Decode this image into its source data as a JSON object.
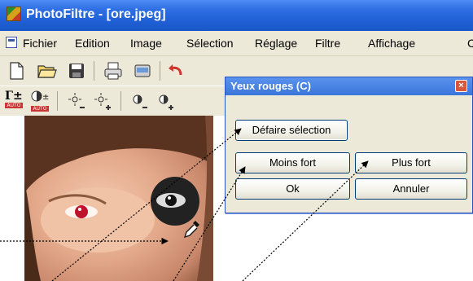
{
  "app": {
    "title": "PhotoFiltre - [ore.jpeg]"
  },
  "menubar": {
    "items": [
      "Fichier",
      "Edition",
      "Image",
      "Sélection",
      "Réglage",
      "Filtre",
      "Affichage",
      "C"
    ]
  },
  "toolbar1": {
    "icons": [
      "new-file-icon",
      "open-folder-icon",
      "save-icon",
      "print-icon",
      "scan-icon",
      "undo-icon"
    ]
  },
  "toolbar2": {
    "icons": [
      "gamma-auto-icon",
      "contrast-auto-icon",
      "brightness-minus-icon",
      "brightness-plus-icon",
      "contrast-minus-icon",
      "contrast-plus-icon"
    ],
    "gamma_text": "Γ±",
    "auto_text": "AUTO"
  },
  "dialog": {
    "title": "Yeux rouges (C)",
    "close_glyph": "×",
    "buttons": {
      "undo_selection": "Défaire sélection",
      "less_strong": "Moins fort",
      "more_strong": "Plus fort",
      "ok": "Ok",
      "cancel": "Annuler"
    }
  },
  "colors": {
    "title_blue": "#2f6fe4",
    "dialog_bg": "#ece9d8",
    "red_eye": "#c1122c"
  }
}
